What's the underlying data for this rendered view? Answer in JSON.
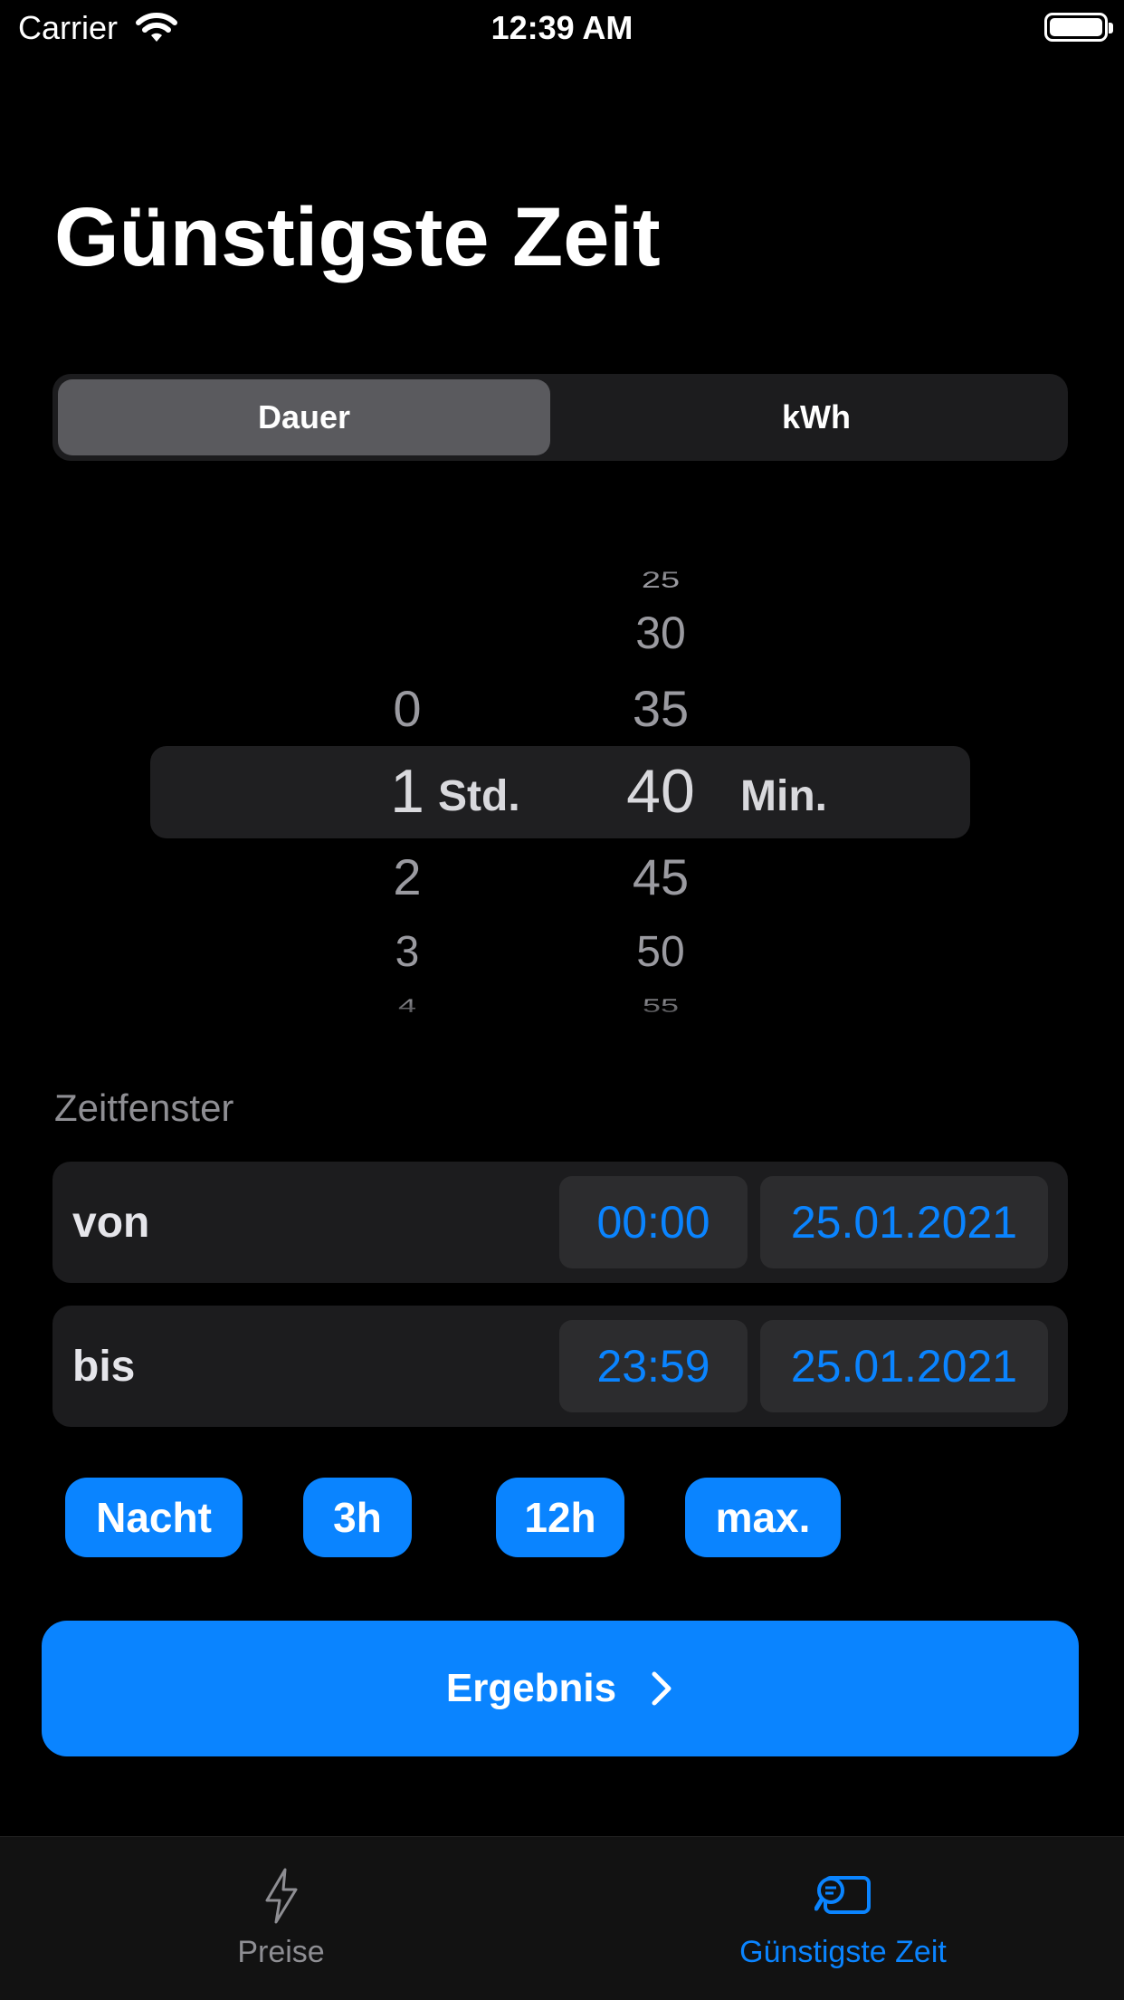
{
  "status_bar": {
    "carrier": "Carrier",
    "time": "12:39 AM"
  },
  "page": {
    "title": "Günstigste Zeit"
  },
  "segmented": {
    "options": [
      "Dauer",
      "kWh"
    ],
    "selected": "Dauer"
  },
  "picker": {
    "hours": [
      "0",
      "1",
      "2",
      "3",
      "4"
    ],
    "minutes": [
      "25",
      "30",
      "35",
      "40",
      "45",
      "50",
      "55"
    ],
    "selected_hour": "1",
    "selected_minute": "40",
    "hour_unit": "Std.",
    "minute_unit": "Min."
  },
  "time_window": {
    "label": "Zeitfenster",
    "from": {
      "label": "von",
      "time": "00:00",
      "date": "25.01.2021"
    },
    "to": {
      "label": "bis",
      "time": "23:59",
      "date": "25.01.2021"
    }
  },
  "quick_buttons": [
    "Nacht",
    "3h",
    "12h",
    "max."
  ],
  "result_button": {
    "label": "Ergebnis"
  },
  "tabbar": {
    "tabs": [
      {
        "label": "Preise",
        "icon": "bolt-icon"
      },
      {
        "label": "Günstigste Zeit",
        "icon": "search-chart-icon"
      }
    ],
    "active_index": 1
  },
  "colors": {
    "accent": "#0a84ff",
    "background": "#000000"
  }
}
